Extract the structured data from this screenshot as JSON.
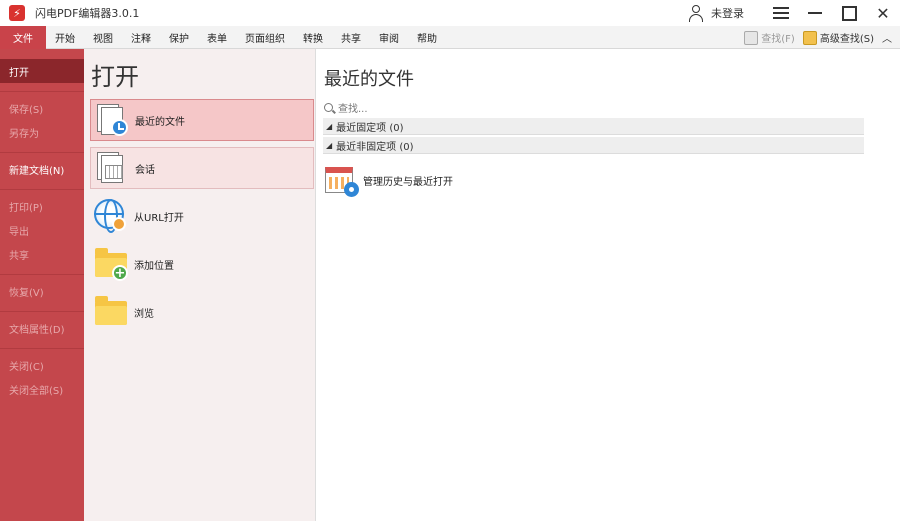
{
  "app": {
    "title": "闪电PDF编辑器3.0.1",
    "logo_glyph": "⚡"
  },
  "title_bar": {
    "login_label": "未登录"
  },
  "ribbon": {
    "tabs": [
      "文件",
      "开始",
      "视图",
      "注释",
      "保护",
      "表单",
      "页面组织",
      "转换",
      "共享",
      "审阅",
      "帮助"
    ],
    "active_tab": "文件",
    "find_label": "查找(F)",
    "advanced_find_label": "高级查找(S)",
    "collapse_icon": "chevron-up-icon"
  },
  "sidebar": {
    "items": [
      {
        "label": "打开",
        "state": "selected"
      },
      {
        "label": "保存(S)",
        "state": "muted"
      },
      {
        "label": "另存为",
        "state": "muted"
      },
      {
        "label": "新建文档(N)",
        "state": "normal"
      },
      {
        "label": "打印(P)",
        "state": "muted"
      },
      {
        "label": "导出",
        "state": "muted"
      },
      {
        "label": "共享",
        "state": "muted"
      },
      {
        "label": "恢复(V)",
        "state": "muted"
      },
      {
        "label": "文档属性(D)",
        "state": "muted"
      },
      {
        "label": "关闭(C)",
        "state": "muted"
      },
      {
        "label": "关闭全部(S)",
        "state": "muted"
      }
    ]
  },
  "open_panel": {
    "title": "打开",
    "items": [
      {
        "label": "最近的文件",
        "icon": "recent-files-icon"
      },
      {
        "label": "会话",
        "icon": "session-icon"
      },
      {
        "label": "从URL打开",
        "icon": "globe-link-icon"
      },
      {
        "label": "添加位置",
        "icon": "add-folder-icon"
      },
      {
        "label": "浏览",
        "icon": "folder-icon"
      }
    ]
  },
  "recent_panel": {
    "title": "最近的文件",
    "search_placeholder": "查找...",
    "groups": [
      {
        "label": "最近固定项 (0)"
      },
      {
        "label": "最近非固定项 (0)"
      }
    ],
    "manage_label": "管理历史与最近打开"
  },
  "colors": {
    "accent": "#c9434a",
    "sidebar_bg": "#c4474c",
    "sidebar_selected": "#8b262b",
    "selected_item_bg": "#f5c7c8"
  }
}
